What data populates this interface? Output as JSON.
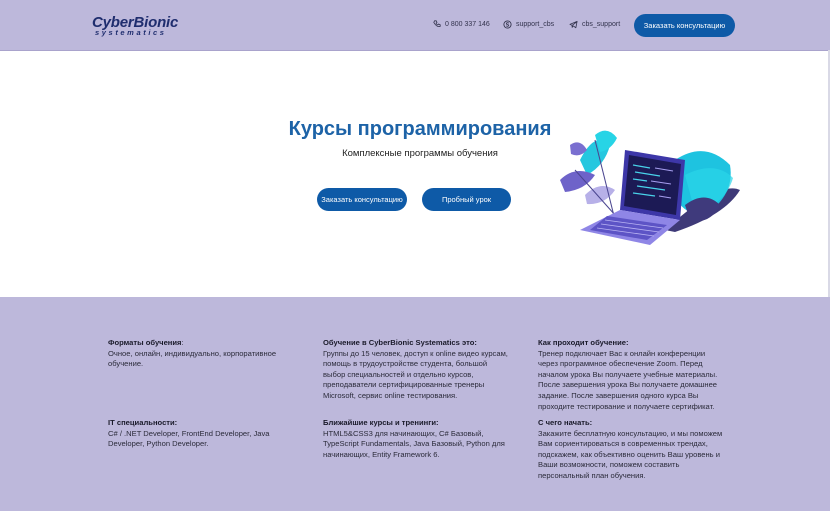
{
  "header": {
    "logo_brand": "CyberBionic",
    "logo_sub": "systematics",
    "phone": "0 800 337 146",
    "skype": "support_cbs",
    "telegram": "cbs_support",
    "cta": "Заказать консультацию"
  },
  "hero": {
    "title": "Курсы программирования",
    "subtitle": "Комплексные программы обучения",
    "btn_consult": "Заказать консультацию",
    "btn_trial": "Пробный урок"
  },
  "info": {
    "formats_title": "Форматы обучения",
    "formats_colon": ":",
    "formats_text": "Очное, онлайн, индивидуально, корпоративное обучение.",
    "it_title": "IT специальности:",
    "it_text": "C# / .NET Developer, FrontEnd Developer, Java Developer, Python Developer.",
    "training_title": "Обучение в CyberBionic Systematics это:",
    "training_text": "Группы до 15 человек, доступ к online видео курсам, помощь в трудоустройстве студента, большой выбор специальностей и отдельно курсов, преподаватели сертифицированные тренеры Microsoft, сервис online тестирования.",
    "nearest_title": "Ближайшие курсы и тренинги:",
    "nearest_text": "HTML5&CSS3 для начинающих, C# Базовый, TypeScript Fundamentals, Java Базовый, Python для начинающих, Entity Framework 6.",
    "how_title": "Как проходит обучение:",
    "how_text": "Тренер подключает Вас к онлайн конференции через программное обеспечение Zoom. Перед началом урока Вы получаете учебные материалы. После завершения урока Вы получаете домашнее задание. После завершения одного курса Вы проходите тестирование и получаете сертификат.",
    "start_title": "С чего начать:",
    "start_text": "Закажите бесплатную консультацию, и мы поможем Вам сориентироваться в современных трендах, подскажем, как объективно оценить Ваш уровень и Ваши возможности, поможем составить персональный план обучения."
  },
  "colors": {
    "band": "#bdb8db",
    "accent": "#0e5aa7",
    "title": "#1d63a7"
  },
  "icons": [
    "phone-icon",
    "skype-icon",
    "telegram-icon"
  ]
}
